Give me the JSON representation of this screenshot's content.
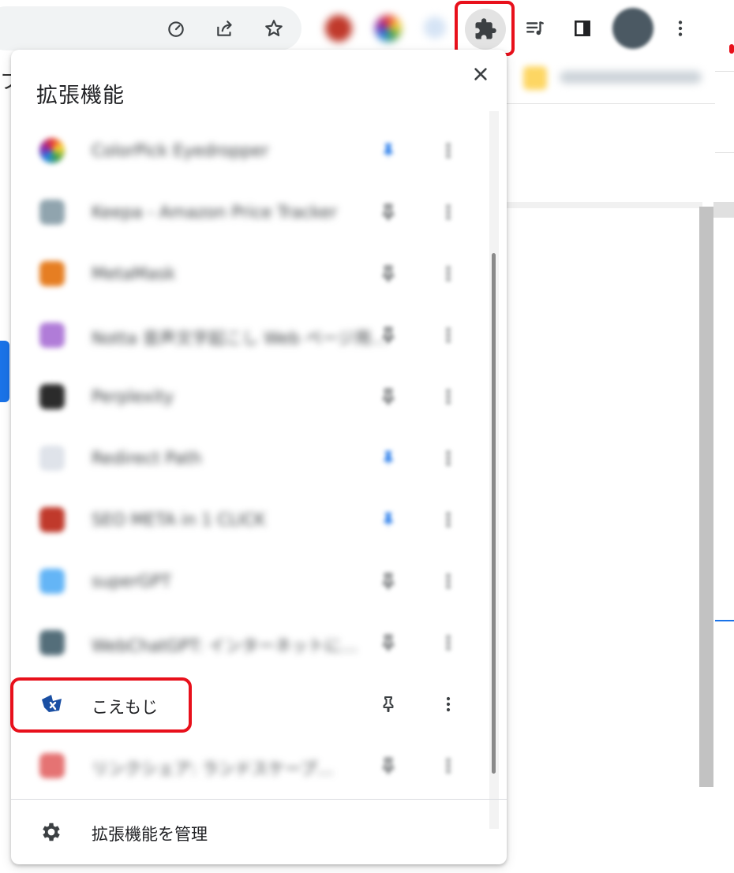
{
  "toolbar": {
    "icons": [
      "performance-icon",
      "share-icon",
      "bookmark-star-icon",
      "extensions-puzzle-icon",
      "media-queue-icon",
      "side-panel-icon",
      "menu-dots-icon"
    ],
    "pinned_extension_colors": [
      "#c0392b",
      "#8e6bd8",
      "#d6e4f5"
    ]
  },
  "background": {
    "partial_text": "ブ"
  },
  "popup": {
    "title": "拡張機能",
    "close_icon": "close-icon",
    "extensions": [
      {
        "name": "ColorPick Eyedropper",
        "pinned": true,
        "icon_color": "#7cb342"
      },
      {
        "name": "Keepa - Amazon Price Tracker",
        "pinned": false,
        "icon_color": "#90a4ae"
      },
      {
        "name": "MetaMask",
        "pinned": false,
        "icon_color": "#e67e22"
      },
      {
        "name": "Notta 音声文字起こし Web ページ用…",
        "pinned": false,
        "icon_color": "#b07cd8"
      },
      {
        "name": "Perplexity",
        "pinned": false,
        "icon_color": "#2b2b2b"
      },
      {
        "name": "Redirect Path",
        "pinned": true,
        "icon_color": "#dfe3ea"
      },
      {
        "name": "SEO META in 1 CLICK",
        "pinned": true,
        "icon_color": "#c0392b"
      },
      {
        "name": "superGPT",
        "pinned": false,
        "icon_color": "#64b5f6"
      },
      {
        "name": "WebChatGPT: インターネットに…",
        "pinned": false,
        "icon_color": "#546e7a"
      },
      {
        "name": "こえもじ",
        "pinned": false,
        "icon_color": "#1a4fa3"
      },
      {
        "name": "リンクシェア: ランドスケープ…",
        "pinned": false,
        "icon_color": "#e57373"
      }
    ],
    "manage_label": "拡張機能を管理"
  },
  "colors": {
    "highlight": "#e8101b",
    "accent": "#1a73e8"
  }
}
